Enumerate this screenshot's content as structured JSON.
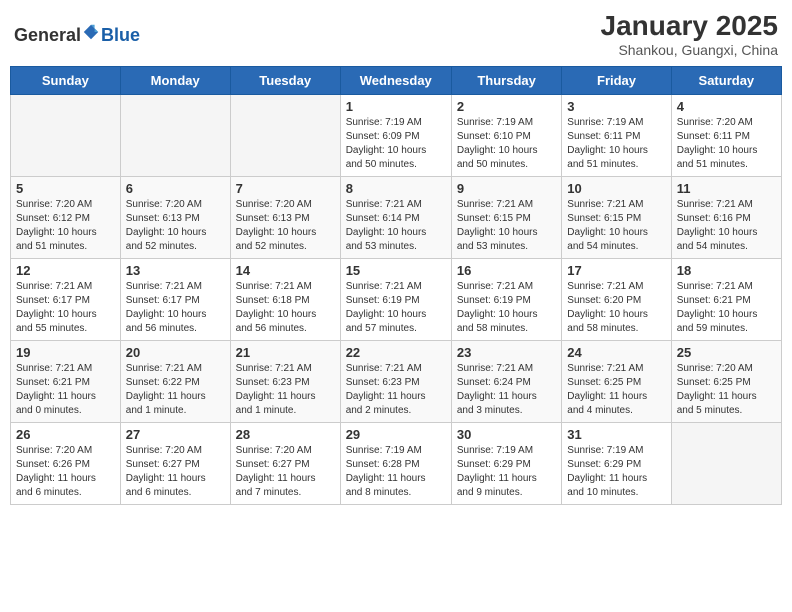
{
  "logo": {
    "general": "General",
    "blue": "Blue"
  },
  "header": {
    "month": "January 2025",
    "location": "Shankou, Guangxi, China"
  },
  "weekdays": [
    "Sunday",
    "Monday",
    "Tuesday",
    "Wednesday",
    "Thursday",
    "Friday",
    "Saturday"
  ],
  "weeks": [
    [
      {
        "day": "",
        "info": ""
      },
      {
        "day": "",
        "info": ""
      },
      {
        "day": "",
        "info": ""
      },
      {
        "day": "1",
        "info": "Sunrise: 7:19 AM\nSunset: 6:09 PM\nDaylight: 10 hours\nand 50 minutes."
      },
      {
        "day": "2",
        "info": "Sunrise: 7:19 AM\nSunset: 6:10 PM\nDaylight: 10 hours\nand 50 minutes."
      },
      {
        "day": "3",
        "info": "Sunrise: 7:19 AM\nSunset: 6:11 PM\nDaylight: 10 hours\nand 51 minutes."
      },
      {
        "day": "4",
        "info": "Sunrise: 7:20 AM\nSunset: 6:11 PM\nDaylight: 10 hours\nand 51 minutes."
      }
    ],
    [
      {
        "day": "5",
        "info": "Sunrise: 7:20 AM\nSunset: 6:12 PM\nDaylight: 10 hours\nand 51 minutes."
      },
      {
        "day": "6",
        "info": "Sunrise: 7:20 AM\nSunset: 6:13 PM\nDaylight: 10 hours\nand 52 minutes."
      },
      {
        "day": "7",
        "info": "Sunrise: 7:20 AM\nSunset: 6:13 PM\nDaylight: 10 hours\nand 52 minutes."
      },
      {
        "day": "8",
        "info": "Sunrise: 7:21 AM\nSunset: 6:14 PM\nDaylight: 10 hours\nand 53 minutes."
      },
      {
        "day": "9",
        "info": "Sunrise: 7:21 AM\nSunset: 6:15 PM\nDaylight: 10 hours\nand 53 minutes."
      },
      {
        "day": "10",
        "info": "Sunrise: 7:21 AM\nSunset: 6:15 PM\nDaylight: 10 hours\nand 54 minutes."
      },
      {
        "day": "11",
        "info": "Sunrise: 7:21 AM\nSunset: 6:16 PM\nDaylight: 10 hours\nand 54 minutes."
      }
    ],
    [
      {
        "day": "12",
        "info": "Sunrise: 7:21 AM\nSunset: 6:17 PM\nDaylight: 10 hours\nand 55 minutes."
      },
      {
        "day": "13",
        "info": "Sunrise: 7:21 AM\nSunset: 6:17 PM\nDaylight: 10 hours\nand 56 minutes."
      },
      {
        "day": "14",
        "info": "Sunrise: 7:21 AM\nSunset: 6:18 PM\nDaylight: 10 hours\nand 56 minutes."
      },
      {
        "day": "15",
        "info": "Sunrise: 7:21 AM\nSunset: 6:19 PM\nDaylight: 10 hours\nand 57 minutes."
      },
      {
        "day": "16",
        "info": "Sunrise: 7:21 AM\nSunset: 6:19 PM\nDaylight: 10 hours\nand 58 minutes."
      },
      {
        "day": "17",
        "info": "Sunrise: 7:21 AM\nSunset: 6:20 PM\nDaylight: 10 hours\nand 58 minutes."
      },
      {
        "day": "18",
        "info": "Sunrise: 7:21 AM\nSunset: 6:21 PM\nDaylight: 10 hours\nand 59 minutes."
      }
    ],
    [
      {
        "day": "19",
        "info": "Sunrise: 7:21 AM\nSunset: 6:21 PM\nDaylight: 11 hours\nand 0 minutes."
      },
      {
        "day": "20",
        "info": "Sunrise: 7:21 AM\nSunset: 6:22 PM\nDaylight: 11 hours\nand 1 minute."
      },
      {
        "day": "21",
        "info": "Sunrise: 7:21 AM\nSunset: 6:23 PM\nDaylight: 11 hours\nand 1 minute."
      },
      {
        "day": "22",
        "info": "Sunrise: 7:21 AM\nSunset: 6:23 PM\nDaylight: 11 hours\nand 2 minutes."
      },
      {
        "day": "23",
        "info": "Sunrise: 7:21 AM\nSunset: 6:24 PM\nDaylight: 11 hours\nand 3 minutes."
      },
      {
        "day": "24",
        "info": "Sunrise: 7:21 AM\nSunset: 6:25 PM\nDaylight: 11 hours\nand 4 minutes."
      },
      {
        "day": "25",
        "info": "Sunrise: 7:20 AM\nSunset: 6:25 PM\nDaylight: 11 hours\nand 5 minutes."
      }
    ],
    [
      {
        "day": "26",
        "info": "Sunrise: 7:20 AM\nSunset: 6:26 PM\nDaylight: 11 hours\nand 6 minutes."
      },
      {
        "day": "27",
        "info": "Sunrise: 7:20 AM\nSunset: 6:27 PM\nDaylight: 11 hours\nand 6 minutes."
      },
      {
        "day": "28",
        "info": "Sunrise: 7:20 AM\nSunset: 6:27 PM\nDaylight: 11 hours\nand 7 minutes."
      },
      {
        "day": "29",
        "info": "Sunrise: 7:19 AM\nSunset: 6:28 PM\nDaylight: 11 hours\nand 8 minutes."
      },
      {
        "day": "30",
        "info": "Sunrise: 7:19 AM\nSunset: 6:29 PM\nDaylight: 11 hours\nand 9 minutes."
      },
      {
        "day": "31",
        "info": "Sunrise: 7:19 AM\nSunset: 6:29 PM\nDaylight: 11 hours\nand 10 minutes."
      },
      {
        "day": "",
        "info": ""
      }
    ]
  ]
}
